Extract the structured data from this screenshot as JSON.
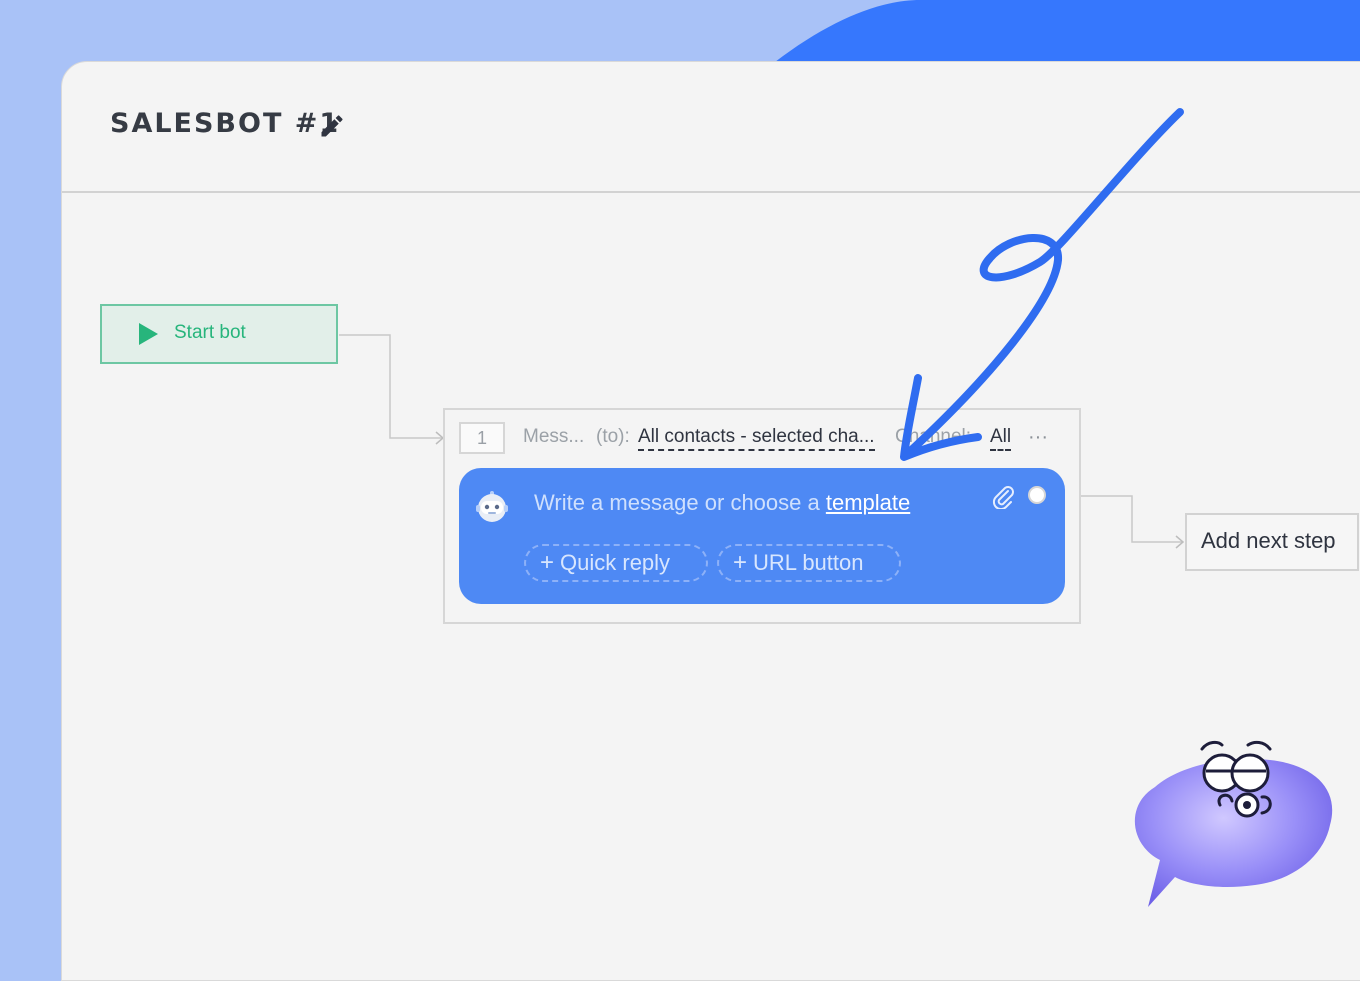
{
  "header": {
    "title": "SALESBOT #1"
  },
  "start_node": {
    "label": "Start bot"
  },
  "step": {
    "number": "1",
    "name": "Mess...",
    "to_label": "(to):",
    "recipients": "All contacts - selected cha...",
    "channel_label": "Channel:",
    "channel_value": "All",
    "more": "···"
  },
  "message": {
    "placeholder": "Write a message or choose a",
    "template_link": "template",
    "quick_reply": "Quick reply",
    "url_button": "URL button",
    "plus": "+"
  },
  "next_step": {
    "label": "Add next step"
  },
  "icons": {
    "edit": "pencil-icon",
    "play": "play-icon",
    "avatar": "robot-icon",
    "attach": "paperclip-icon",
    "arrow": "hand-drawn-arrow",
    "mascot": "speech-bubble-mascot"
  },
  "colors": {
    "page_bg": "#a9c2f7",
    "wave": "#3677fd",
    "start_green": "#27b57c",
    "card_blue": "#4e89f4",
    "scribble": "#2f6cf0",
    "mascot_purple": "#9a90f8"
  }
}
